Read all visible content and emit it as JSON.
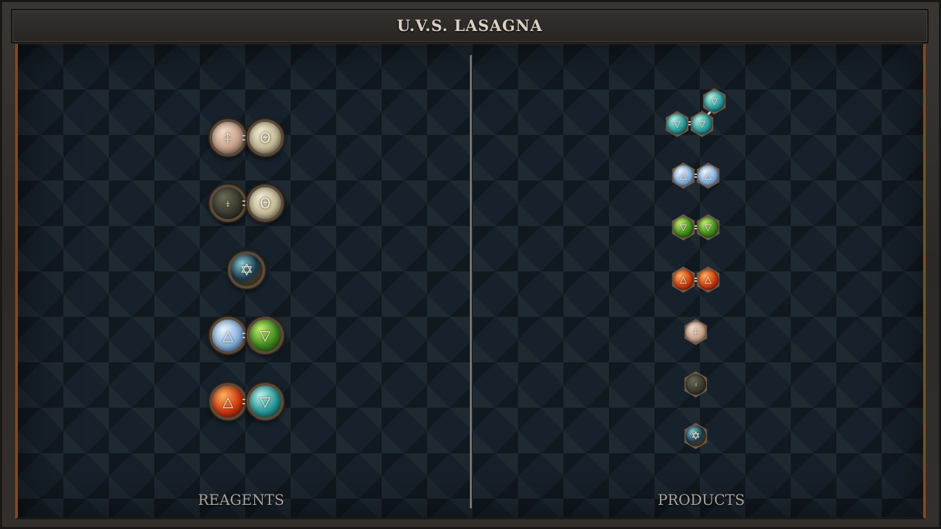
{
  "header": {
    "title": "U.V.S. LASAGNA"
  },
  "columns": {
    "reagents_label": "REAGENTS",
    "products_label": "PRODUCTS"
  },
  "elements": {
    "salt": "🜔",
    "quintessence": "🜀",
    "mors": "🜞",
    "vitae": "✡",
    "air": "△",
    "earth": "▽",
    "fire": "△",
    "water": "▽"
  },
  "glyphs": {
    "salt_top": "⍏",
    "mors": "⍖",
    "quintessence": "Θ",
    "vitae": "✡",
    "air": "△",
    "earth": "▽",
    "fire": "△",
    "water": "▽"
  }
}
